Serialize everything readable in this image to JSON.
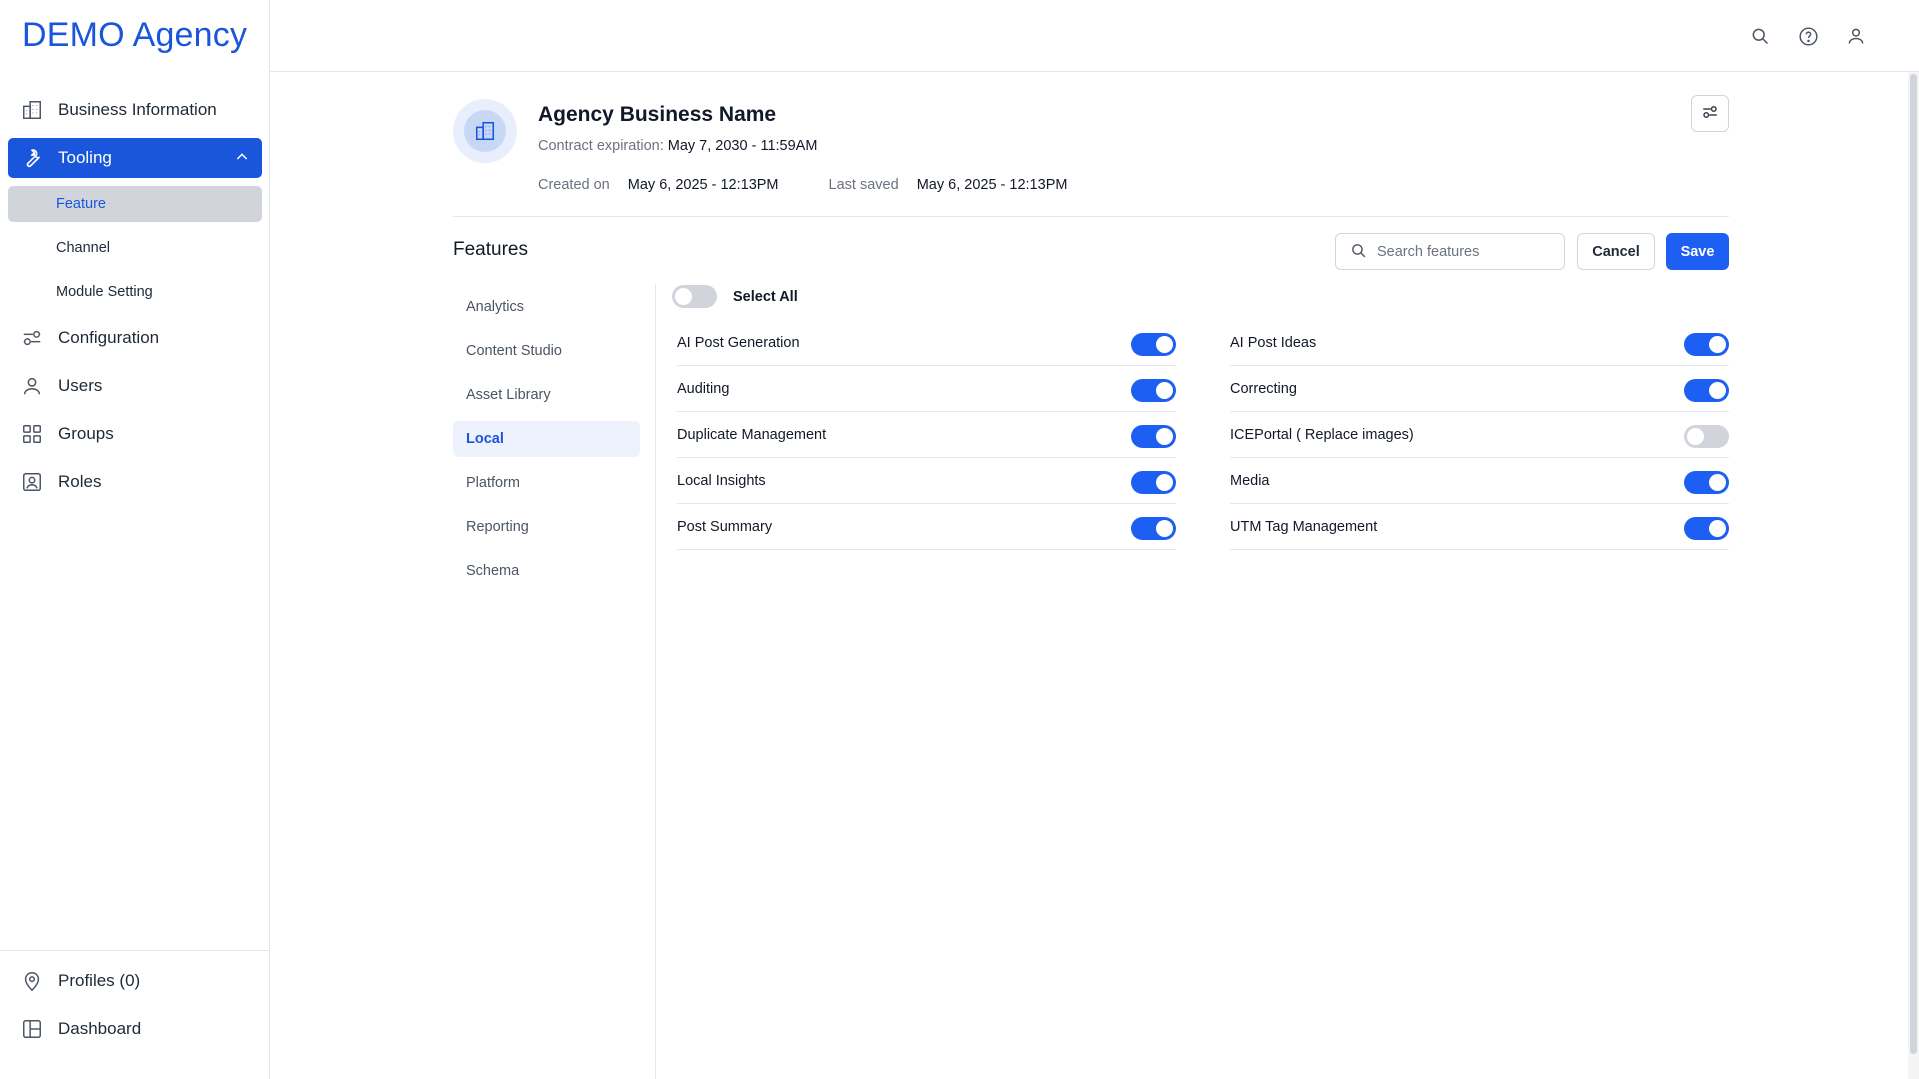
{
  "brand": "DEMO Agency",
  "sidebar": {
    "items": [
      {
        "label": "Business Information",
        "icon": "building-icon"
      },
      {
        "label": "Tooling",
        "icon": "wrench-icon"
      },
      {
        "label": "Configuration",
        "icon": "sliders-icon"
      },
      {
        "label": "Users",
        "icon": "user-icon"
      },
      {
        "label": "Groups",
        "icon": "grid-icon"
      },
      {
        "label": "Roles",
        "icon": "id-badge-icon"
      }
    ],
    "sub_items": [
      {
        "label": "Feature"
      },
      {
        "label": "Channel"
      },
      {
        "label": "Module Setting"
      }
    ],
    "bottom": [
      {
        "label": "Profiles (0)",
        "icon": "map-pin-icon"
      },
      {
        "label": "Dashboard",
        "icon": "layout-icon"
      }
    ]
  },
  "header": {
    "business_name": "Agency Business Name",
    "contract_label": "Contract expiration:",
    "contract_value": "May 7, 2030 - 11:59AM",
    "created_label": "Created on",
    "created_value": "May 6, 2025 - 12:13PM",
    "saved_label": "Last saved",
    "saved_value": "May 6, 2025 - 12:13PM"
  },
  "features": {
    "title": "Features",
    "search_placeholder": "Search features",
    "cancel_label": "Cancel",
    "save_label": "Save",
    "select_all_label": "Select All",
    "select_all_on": false,
    "categories": [
      "Analytics",
      "Content Studio",
      "Asset Library",
      "Local",
      "Platform",
      "Reporting",
      "Schema"
    ],
    "active_category": "Local",
    "left": [
      {
        "label": "AI Post Generation",
        "on": true
      },
      {
        "label": "Auditing",
        "on": true
      },
      {
        "label": "Duplicate Management",
        "on": true
      },
      {
        "label": "Local Insights",
        "on": true
      },
      {
        "label": "Post Summary",
        "on": true
      }
    ],
    "right": [
      {
        "label": "AI Post Ideas",
        "on": true
      },
      {
        "label": "Correcting",
        "on": true
      },
      {
        "label": "ICEPortal ( Replace images)",
        "on": false
      },
      {
        "label": "Media",
        "on": true
      },
      {
        "label": "UTM Tag Management",
        "on": true
      }
    ]
  },
  "colors": {
    "accent": "#1a56db",
    "toggle_on": "#1d5ff2",
    "toggle_off": "#d1d5db"
  }
}
